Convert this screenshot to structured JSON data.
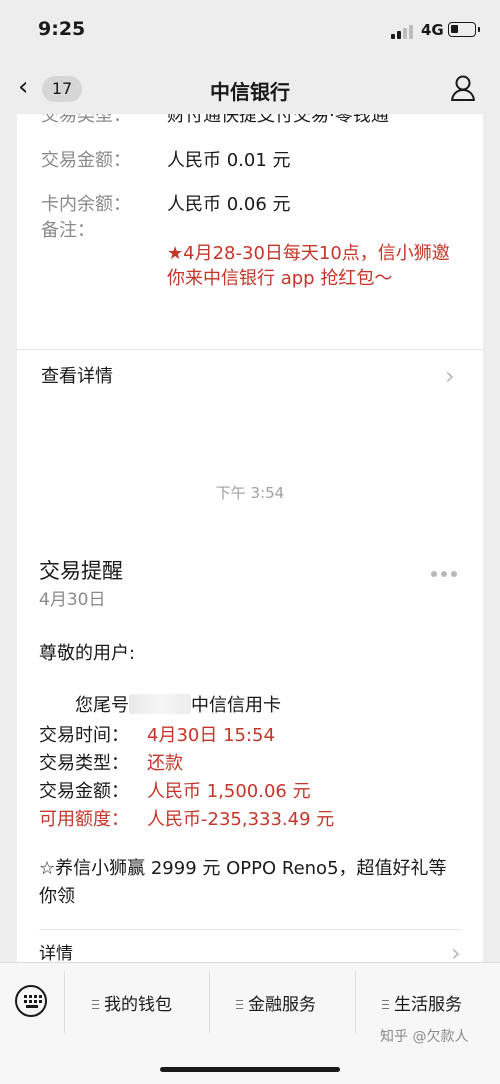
{
  "status_bar": {
    "time": "9:25",
    "network": "4G"
  },
  "nav": {
    "back_count": "17",
    "title": "中信银行"
  },
  "card1": {
    "cut_label": "交易类型：",
    "cut_value": "财付通快捷支付交易·零钱通",
    "amount_label": "交易金额：",
    "amount_value": "人民币 0.01 元",
    "balance_label": "卡内余额：",
    "balance_value": "人民币 0.06 元",
    "note_label": "备注：",
    "note_value": "★4月28-30日每天10点，信小狮邀你来中信银行 app 抢红包～",
    "details_label": "查看详情"
  },
  "timestamp": "下午 3:54",
  "card2": {
    "title": "交易提醒",
    "date": "4月30日",
    "greeting": "尊敬的用户:",
    "card_prefix": "您尾号",
    "card_suffix": "中信信用卡",
    "time_label": "交易时间：",
    "time_value": "4月30日 15:54",
    "type_label": "交易类型：",
    "type_value": "还款",
    "amount_label": "交易金额：",
    "amount_value": "人民币 1,500.06 元",
    "credit_label": "可用额度：",
    "credit_value": "人民币-235,333.49 元",
    "promo": "☆养信小狮赢 2999 元 OPPO Reno5，超值好礼等你领",
    "details_label": "详情"
  },
  "bottom_menu": [
    "我的钱包",
    "金融服务",
    "生活服务"
  ],
  "watermark": "知乎 @欠款人",
  "colors": {
    "accent_red": "#c5362a",
    "background": "#ededed"
  }
}
